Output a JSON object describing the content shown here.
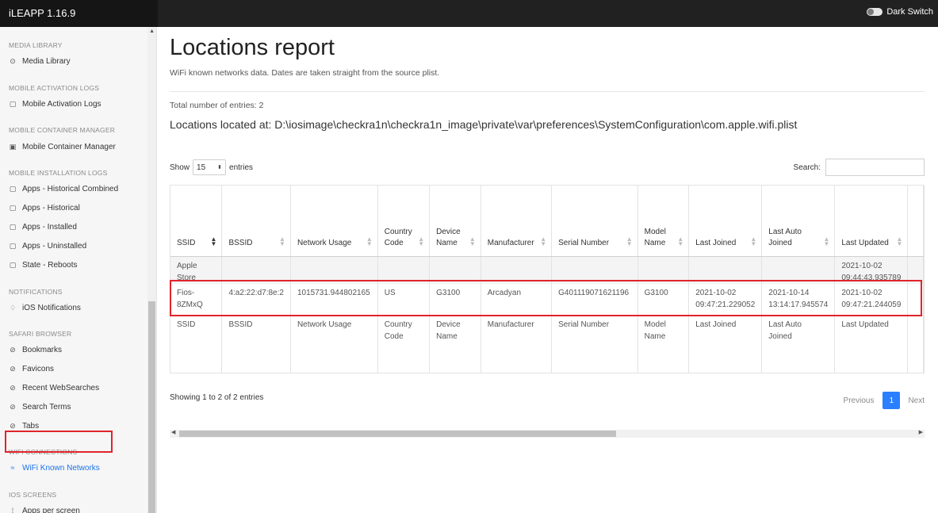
{
  "app": {
    "title": "iLEAPP 1.16.9",
    "dark_switch_label": "Dark Switch"
  },
  "sidebar": {
    "sections": [
      {
        "heading": "MEDIA LIBRARY",
        "items": [
          {
            "label": "Media Library",
            "icon": "play-circle-icon"
          }
        ]
      },
      {
        "heading": "MOBILE ACTIVATION LOGS",
        "items": [
          {
            "label": "Mobile Activation Logs",
            "icon": "clipboard-icon"
          }
        ]
      },
      {
        "heading": "MOBILE CONTAINER MANAGER",
        "items": [
          {
            "label": "Mobile Container Manager",
            "icon": "save-icon"
          }
        ]
      },
      {
        "heading": "MOBILE INSTALLATION LOGS",
        "items": [
          {
            "label": "Apps - Historical Combined",
            "icon": "clipboard-icon"
          },
          {
            "label": "Apps - Historical",
            "icon": "clipboard-icon"
          },
          {
            "label": "Apps - Installed",
            "icon": "clipboard-icon"
          },
          {
            "label": "Apps - Uninstalled",
            "icon": "clipboard-icon"
          },
          {
            "label": "State - Reboots",
            "icon": "clipboard-icon"
          }
        ]
      },
      {
        "heading": "NOTIFICATIONS",
        "items": [
          {
            "label": "iOS Notifications",
            "icon": "bell-icon"
          }
        ]
      },
      {
        "heading": "SAFARI BROWSER",
        "items": [
          {
            "label": "Bookmarks",
            "icon": "compass-icon"
          },
          {
            "label": "Favicons",
            "icon": "compass-icon"
          },
          {
            "label": "Recent WebSearches",
            "icon": "compass-icon"
          },
          {
            "label": "Search Terms",
            "icon": "compass-icon"
          },
          {
            "label": "Tabs",
            "icon": "compass-icon"
          }
        ]
      },
      {
        "heading": "WIFI CONNECTIONS",
        "items": [
          {
            "label": "WiFi Known Networks",
            "icon": "wifi-icon",
            "active": true
          }
        ]
      },
      {
        "heading": "IOS SCREENS",
        "items": [
          {
            "label": "Apps per screen",
            "icon": "grid-icon"
          }
        ]
      }
    ]
  },
  "report": {
    "title": "Locations report",
    "subtitle": "WiFi known networks data. Dates are taken straight from the source plist.",
    "total_entries": "Total number of entries: 2",
    "located_at": "Locations located at: D:\\iosimage\\checkra1n\\checkra1n_image\\private\\var\\preferences\\SystemConfiguration\\com.apple.wifi.plist"
  },
  "controls": {
    "show_label": "Show",
    "page_size": "15",
    "entries_label": "entries",
    "search_label": "Search:",
    "showing_text": "Showing 1 to 2 of 2 entries",
    "prev_label": "Previous",
    "page_number": "1",
    "next_label": "Next"
  },
  "table": {
    "columns": [
      {
        "h1": "",
        "h2": "SSID",
        "foot1": "SSID",
        "foot2": ""
      },
      {
        "h1": "",
        "h2": "BSSID",
        "foot1": "BSSID",
        "foot2": ""
      },
      {
        "h1": "",
        "h2": "Network Usage",
        "foot1": "Network Usage",
        "foot2": ""
      },
      {
        "h1": "Country",
        "h2": "Code",
        "foot1": "Country",
        "foot2": "Code"
      },
      {
        "h1": "Device",
        "h2": "Name",
        "foot1": "Device",
        "foot2": "Name"
      },
      {
        "h1": "",
        "h2": "Manufacturer",
        "foot1": "Manufacturer",
        "foot2": ""
      },
      {
        "h1": "",
        "h2": "Serial Number",
        "foot1": "Serial Number",
        "foot2": ""
      },
      {
        "h1": "Model",
        "h2": "Name",
        "foot1": "Model",
        "foot2": "Name"
      },
      {
        "h1": "",
        "h2": "Last Joined",
        "foot1": "Last Joined",
        "foot2": ""
      },
      {
        "h1": "Last Auto",
        "h2": "Joined",
        "foot1": "Last Auto",
        "foot2": "Joined"
      },
      {
        "h1": "",
        "h2": "Last Updated",
        "foot1": "Last Updated",
        "foot2": ""
      },
      {
        "h1": "",
        "h2": "",
        "foot1": "",
        "foot2": ""
      }
    ],
    "rows": [
      [
        [
          "Apple",
          "Store"
        ],
        [
          ""
        ],
        [
          ""
        ],
        [
          ""
        ],
        [
          ""
        ],
        [
          ""
        ],
        [
          ""
        ],
        [
          ""
        ],
        [
          ""
        ],
        [
          ""
        ],
        [
          "2021-10-02",
          "09:44:43.935789"
        ],
        [
          ""
        ]
      ],
      [
        [
          "Fios-",
          "8ZMxQ"
        ],
        [
          "4:a2:22:d7:8e:2"
        ],
        [
          "1015731.944802165"
        ],
        [
          "US"
        ],
        [
          "G3100"
        ],
        [
          "Arcadyan"
        ],
        [
          "G401119071621196"
        ],
        [
          "G3100"
        ],
        [
          "2021-10-02",
          "09:47:21.229052"
        ],
        [
          "2021-10-14",
          "13:14:17.945574"
        ],
        [
          "2021-10-02",
          "09:47:21.244059"
        ],
        [
          ""
        ]
      ]
    ]
  }
}
